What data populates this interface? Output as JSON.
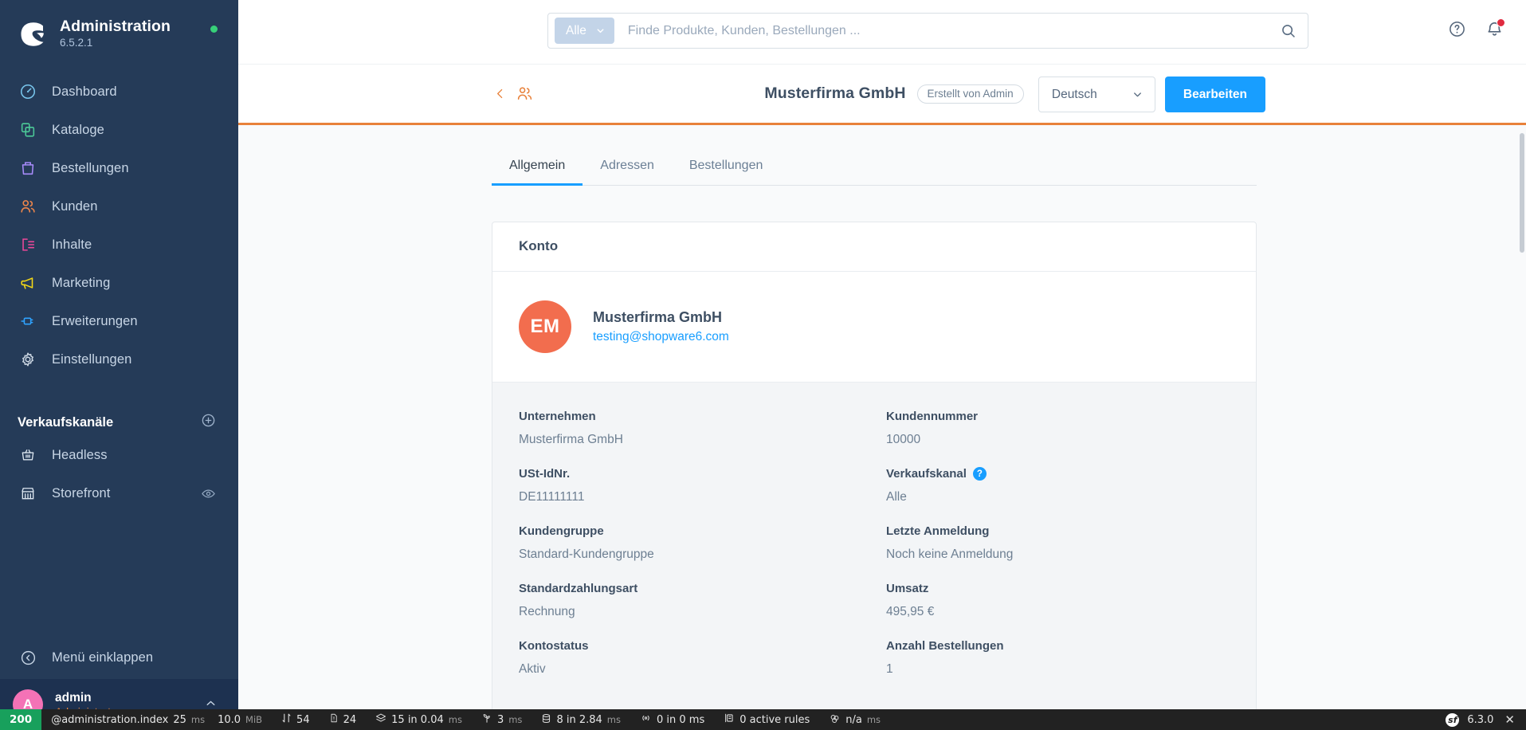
{
  "sidebar": {
    "brand": {
      "title": "Administration",
      "version": "6.5.2.1",
      "status_dot_color": "#37d079"
    },
    "items": [
      {
        "label": "Dashboard",
        "icon": "dashboard-icon",
        "color": "#78c5ec"
      },
      {
        "label": "Kataloge",
        "icon": "catalog-icon",
        "color": "#4cc997"
      },
      {
        "label": "Bestellungen",
        "icon": "orders-icon",
        "color": "#a78bfa"
      },
      {
        "label": "Kunden",
        "icon": "customers-icon",
        "color": "#f0864a"
      },
      {
        "label": "Inhalte",
        "icon": "content-icon",
        "color": "#ec4899"
      },
      {
        "label": "Marketing",
        "icon": "marketing-icon",
        "color": "#f5d916"
      },
      {
        "label": "Erweiterungen",
        "icon": "extensions-icon",
        "color": "#2fa3ff"
      },
      {
        "label": "Einstellungen",
        "icon": "settings-gear-icon",
        "color": "#cdd8e4"
      }
    ],
    "sales_channels": {
      "title": "Verkaufskanäle",
      "add_label": "plus-circle-icon",
      "items": [
        {
          "label": "Headless",
          "icon": "basket-icon"
        },
        {
          "label": "Storefront",
          "icon": "storefront-icon",
          "trailing_icon": "eye-icon"
        }
      ]
    },
    "collapse": {
      "label": "Menü einklappen",
      "icon": "chevron-left-circle-icon"
    },
    "user": {
      "initial": "A",
      "name": "admin",
      "role": "Administrator",
      "chevron": "chevron-up-icon"
    }
  },
  "topbar": {
    "search": {
      "type_label": "Alle",
      "placeholder": "Finde Produkte, Kunden, Bestellungen ...",
      "value": "",
      "search_icon": "magnifier-icon"
    },
    "help_icon": "question-circle-icon",
    "notifications_icon": "bell-icon",
    "notification_badge_color": "#e02b3f"
  },
  "page_header": {
    "back_icon": "chevron-left-icon",
    "entity_icon": "customers-icon",
    "title": "Musterfirma GmbH",
    "badge": "Erstellt von Admin",
    "language": {
      "value": "Deutsch",
      "chevron": "chevron-down-icon"
    },
    "edit_button": "Bearbeiten",
    "accent_color": "#e8813a",
    "primary_color": "#189eff"
  },
  "tabs": [
    {
      "label": "Allgemein",
      "active": true
    },
    {
      "label": "Adressen",
      "active": false
    },
    {
      "label": "Bestellungen",
      "active": false
    }
  ],
  "card": {
    "title": "Konto",
    "account": {
      "avatar_initials": "EM",
      "avatar_color": "#f26d4e",
      "name": "Musterfirma GmbH",
      "email": "testing@shopware6.com"
    },
    "fields": [
      {
        "label": "Unternehmen",
        "value": "Musterfirma GmbH",
        "help": false
      },
      {
        "label": "Kundennummer",
        "value": "10000",
        "help": false
      },
      {
        "label": "USt-IdNr.",
        "value": "DE11111111",
        "help": false
      },
      {
        "label": "Verkaufskanal",
        "value": "Alle",
        "help": true
      },
      {
        "label": "Kundengruppe",
        "value": "Standard-Kundengruppe",
        "help": false
      },
      {
        "label": "Letzte Anmeldung",
        "value": "Noch keine Anmeldung",
        "help": false
      },
      {
        "label": "Standardzahlungsart",
        "value": "Rechnung",
        "help": false
      },
      {
        "label": "Umsatz",
        "value": "495,95 €",
        "help": false
      },
      {
        "label": "Kontostatus",
        "value": "Aktiv",
        "help": false
      },
      {
        "label": "Anzahl Bestellungen",
        "value": "1",
        "help": false
      }
    ]
  },
  "debugbar": {
    "status_code": "200",
    "route": "@administration.index",
    "time_value": "25",
    "time_unit": "ms",
    "memory_value": "10.0",
    "memory_unit": "MiB",
    "items": [
      {
        "icon": "sort-arrows-icon",
        "value": "54",
        "unit": ""
      },
      {
        "icon": "file-icon",
        "value": "24",
        "unit": ""
      },
      {
        "icon": "layers-icon",
        "value": "15 in 0.04",
        "unit": "ms"
      },
      {
        "icon": "twig-icon",
        "value": "3",
        "unit": "ms"
      },
      {
        "icon": "database-icon",
        "value": "8 in 2.84",
        "unit": "ms"
      },
      {
        "icon": "broadcast-icon",
        "value": "0 in 0 ms",
        "unit": ""
      },
      {
        "icon": "rules-icon",
        "value": "0 active rules",
        "unit": ""
      },
      {
        "icon": "cache-icon",
        "value": "n/a",
        "unit": "ms"
      }
    ],
    "symfony_label": "sf",
    "symfony_version": "6.3.0",
    "close_icon": "close-icon"
  }
}
